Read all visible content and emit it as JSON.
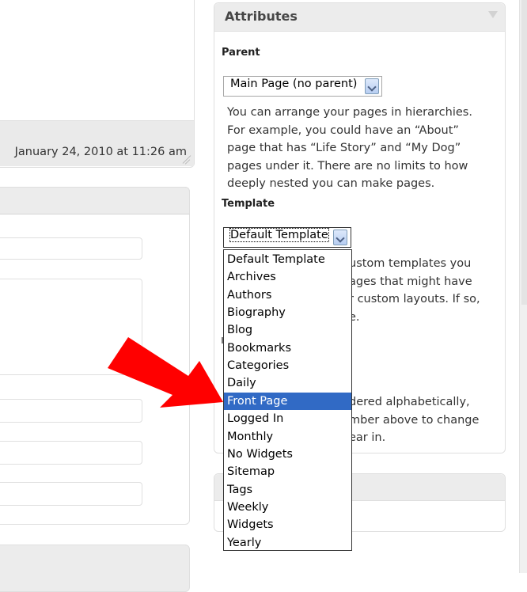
{
  "editor": {
    "last_edited": "January 24, 2010 at 11:26 am"
  },
  "attributes": {
    "title": "Attributes",
    "parent_heading": "Parent",
    "parent_value": "Main Page (no parent)",
    "parent_help": [
      "You can arrange your pages in hierarchies.",
      "For example, you could have an “About”",
      "page that has “Life Story” and “My Dog”",
      "pages under it. There are no limits to how",
      "deeply nested you can make pages."
    ],
    "template_heading": "Template",
    "template_value": "Default Template",
    "template_help_fragments": [
      "ustom templates you",
      "ages that might have",
      "r custom layouts. If so,",
      "e."
    ],
    "order_help_fragments": [
      "dered alphabetically,",
      "mber above to change",
      "ear in."
    ]
  },
  "template_options": [
    "Default Template",
    "Archives",
    "Authors",
    "Biography",
    "Blog",
    "Bookmarks",
    "Categories",
    "Daily",
    "Front Page",
    "Logged In",
    "Monthly",
    "No Widgets",
    "Sitemap",
    "Tags",
    "Weekly",
    "Widgets",
    "Yearly"
  ],
  "template_options_selected": "Front Page",
  "colors": {
    "highlight": "#316ac5",
    "arrow": "#ff0000"
  }
}
